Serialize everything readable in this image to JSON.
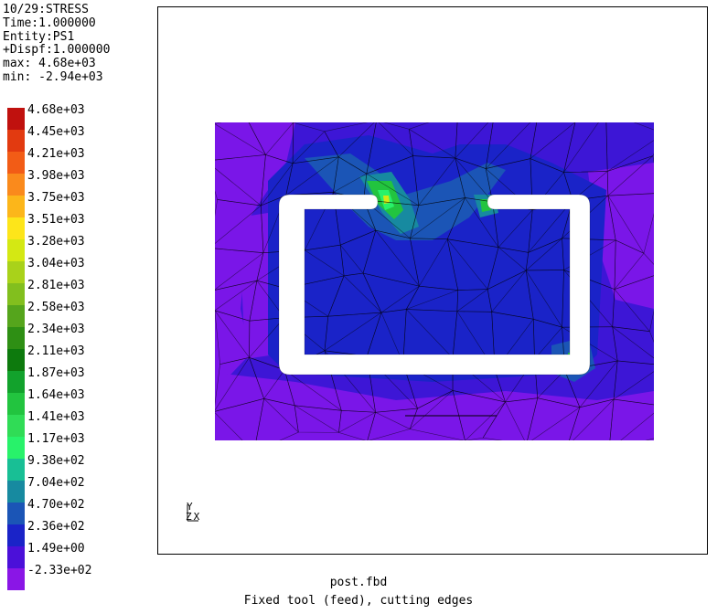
{
  "header": {
    "line1": "10/29:STRESS",
    "line2": "Time:1.000000",
    "line3": "Entity:PS1",
    "line4": "+Dispf:1.000000",
    "line5": "max: 4.68e+03",
    "line6": "min: -2.94e+03"
  },
  "legend": [
    {
      "label": "4.68e+03",
      "color": "#c0110e"
    },
    {
      "label": "4.45e+03",
      "color": "#e23a10"
    },
    {
      "label": "4.21e+03",
      "color": "#f25c16"
    },
    {
      "label": "3.98e+03",
      "color": "#fa8a1c"
    },
    {
      "label": "3.75e+03",
      "color": "#fcb61a"
    },
    {
      "label": "3.51e+03",
      "color": "#fde51a"
    },
    {
      "label": "3.28e+03",
      "color": "#d4e813"
    },
    {
      "label": "3.04e+03",
      "color": "#a9d21a"
    },
    {
      "label": "2.81e+03",
      "color": "#82bf1e"
    },
    {
      "label": "2.58e+03",
      "color": "#55a51c"
    },
    {
      "label": "2.34e+03",
      "color": "#2e8f14"
    },
    {
      "label": "2.11e+03",
      "color": "#0d7a0d"
    },
    {
      "label": "1.87e+03",
      "color": "#12a22c"
    },
    {
      "label": "1.64e+03",
      "color": "#22c43f"
    },
    {
      "label": "1.41e+03",
      "color": "#30dc56"
    },
    {
      "label": "1.17e+03",
      "color": "#28f26a"
    },
    {
      "label": "9.38e+02",
      "color": "#18bf95"
    },
    {
      "label": "7.04e+02",
      "color": "#178aa0"
    },
    {
      "label": "4.70e+02",
      "color": "#1b55b6"
    },
    {
      "label": "2.36e+02",
      "color": "#1a23c8"
    },
    {
      "label": "1.49e+00",
      "color": "#4b10d9"
    },
    {
      "label": "-2.33e+02",
      "color": "#8a16e6"
    }
  ],
  "plot_colors": {
    "base": "#3d16d6",
    "violet": "#7a16e8",
    "blue": "#1a23c8",
    "mid_blue": "#1b55b6",
    "teal": "#178aa0",
    "green": "#22c43f",
    "bright_green": "#28f26a",
    "yellow": "#d4e813",
    "orange": "#fa8a1c"
  },
  "triad": {
    "y": "Y",
    "z": "Z",
    "x": "X"
  },
  "footer": {
    "title": "post.fbd",
    "subtitle": "Fixed tool (feed), cutting edges"
  }
}
